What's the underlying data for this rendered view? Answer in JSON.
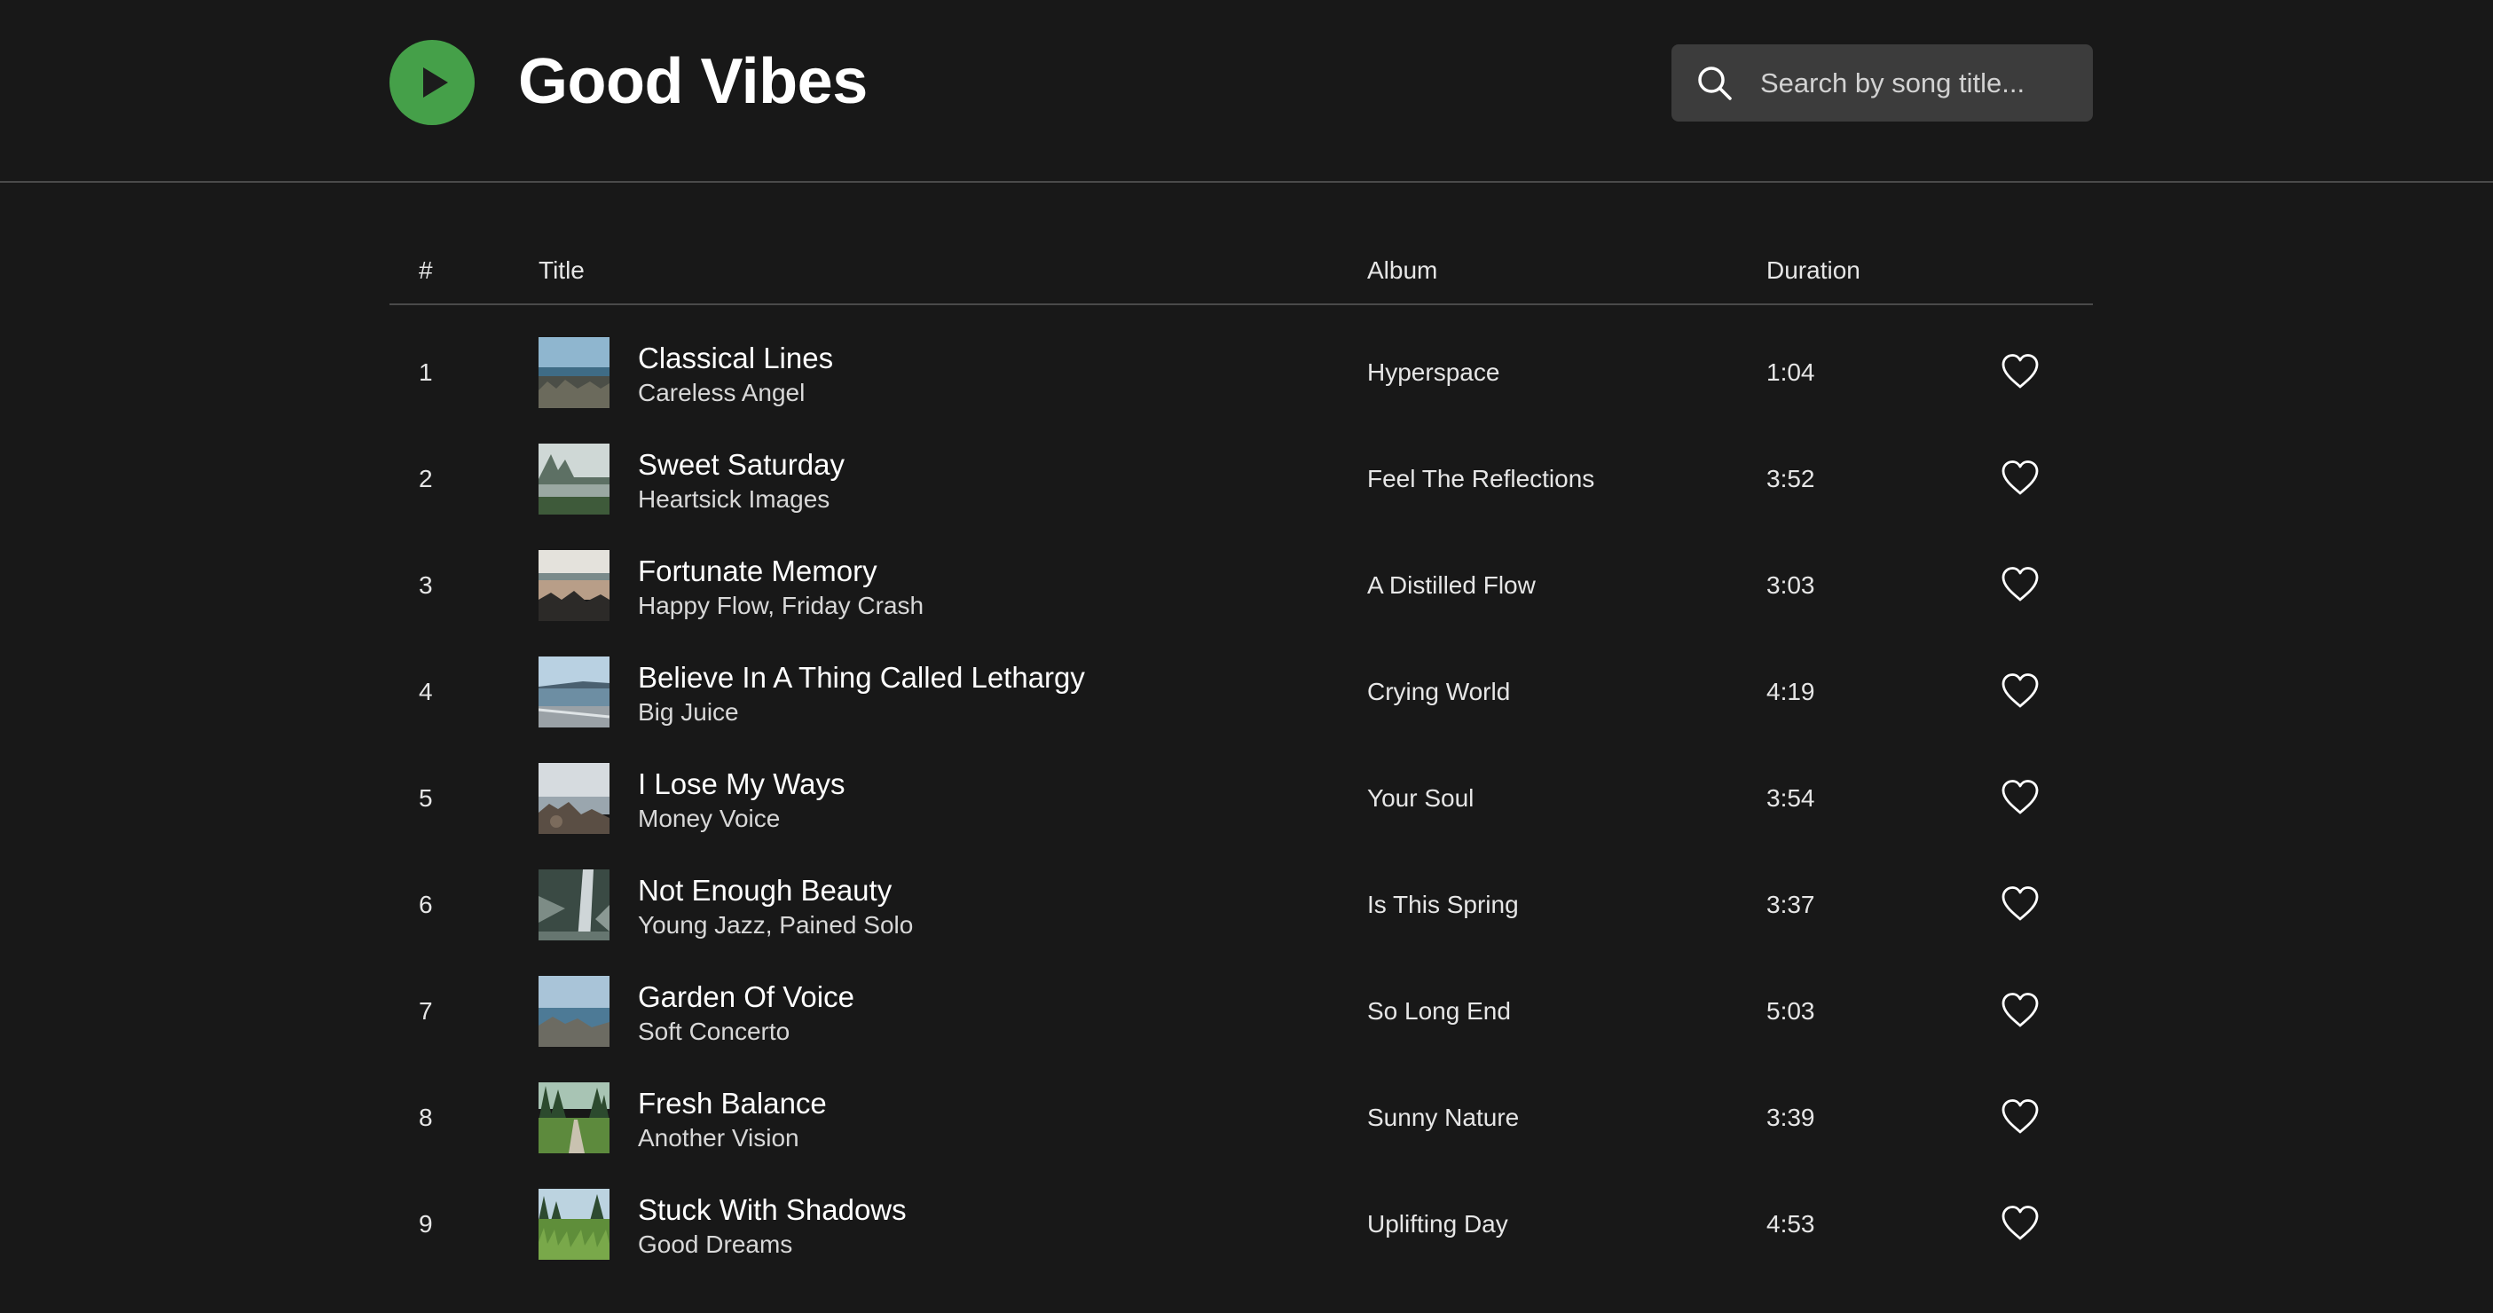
{
  "header": {
    "logo_icon": "play-icon",
    "title": "Good Vibes",
    "accent_color": "#45a049"
  },
  "search": {
    "placeholder": "Search by song title...",
    "value": "",
    "icon": "search-icon"
  },
  "table": {
    "columns": {
      "number": "#",
      "title": "Title",
      "album": "Album",
      "duration": "Duration"
    },
    "rows": [
      {
        "number": "1",
        "title": "Classical Lines",
        "artist": "Careless Angel",
        "album": "Hyperspace",
        "duration": "1:04",
        "thumb": "sea-horizon",
        "favorite": false
      },
      {
        "number": "2",
        "title": "Sweet Saturday",
        "artist": "Heartsick Images",
        "album": "Feel The Reflections",
        "duration": "3:52",
        "thumb": "misty-lake",
        "favorite": false
      },
      {
        "number": "3",
        "title": "Fortunate Memory",
        "artist": "Happy Flow, Friday Crash",
        "album": "A Distilled Flow",
        "duration": "3:03",
        "thumb": "rocky-beach",
        "favorite": false
      },
      {
        "number": "4",
        "title": "Believe In A Thing Called Lethargy",
        "artist": "Big Juice",
        "album": "Crying World",
        "duration": "4:19",
        "thumb": "shoreline",
        "favorite": false
      },
      {
        "number": "5",
        "title": "I Lose My Ways",
        "artist": "Money Voice",
        "album": "Your Soul",
        "duration": "3:54",
        "thumb": "rocks-sea",
        "favorite": false
      },
      {
        "number": "6",
        "title": "Not Enough Beauty",
        "artist": "Young Jazz, Pained Solo",
        "album": "Is This Spring",
        "duration": "3:37",
        "thumb": "waterfall",
        "favorite": false
      },
      {
        "number": "7",
        "title": "Garden Of Voice",
        "artist": "Soft Concerto",
        "album": "So Long End",
        "duration": "5:03",
        "thumb": "coast-rocks",
        "favorite": false
      },
      {
        "number": "8",
        "title": "Fresh Balance",
        "artist": "Another Vision",
        "album": "Sunny Nature",
        "duration": "3:39",
        "thumb": "forest-path",
        "favorite": false
      },
      {
        "number": "9",
        "title": "Stuck With Shadows",
        "artist": "Good Dreams",
        "album": "Uplifting Day",
        "duration": "4:53",
        "thumb": "meadow",
        "favorite": false
      }
    ]
  }
}
